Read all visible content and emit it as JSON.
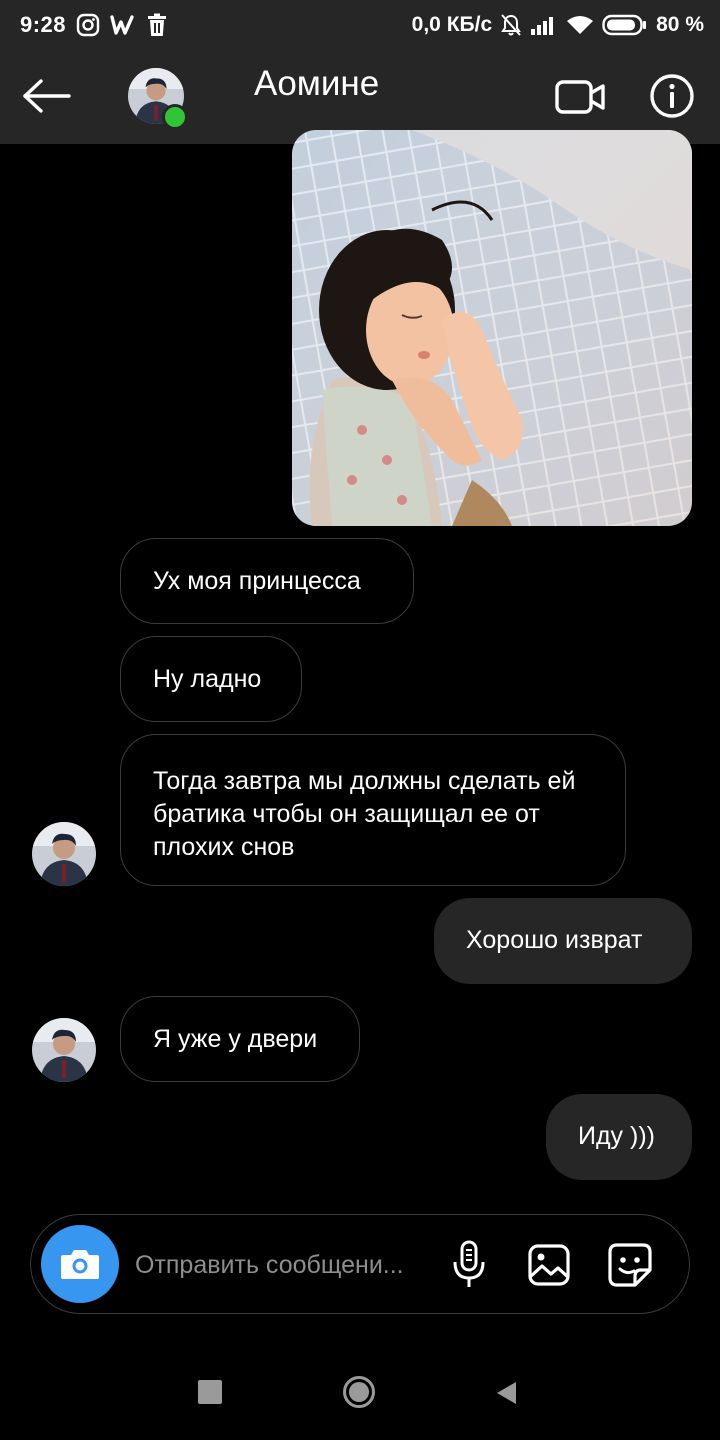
{
  "status_bar": {
    "time": "9:28",
    "network_speed": "0,0 КБ/с",
    "battery": "80 %",
    "icons": [
      "instagram-icon",
      "wattpad-icon",
      "trash-icon",
      "bell-muted-icon",
      "signal-icon",
      "wifi-icon",
      "battery-icon"
    ]
  },
  "header": {
    "title": "Аомине",
    "online": true
  },
  "messages": [
    {
      "direction": "in",
      "text": "Ух моя принцесса"
    },
    {
      "direction": "in",
      "text": "Ну ладно"
    },
    {
      "direction": "in",
      "text": "Тогда завтра мы должны сделать ей братика чтобы он защищал ее от плохих снов"
    },
    {
      "direction": "out",
      "text": "Хорошо изврат"
    },
    {
      "direction": "in",
      "text": "Я уже у двери"
    },
    {
      "direction": "out",
      "text": "Иду )))"
    }
  ],
  "composer": {
    "placeholder": "Отправить сообщени..."
  },
  "colors": {
    "background": "#000000",
    "bar": "#262626",
    "camera_button": "#3797f0",
    "online_dot": "#2fc536",
    "outgoing_bubble": "#262626",
    "incoming_border": "#3b3b3b"
  }
}
